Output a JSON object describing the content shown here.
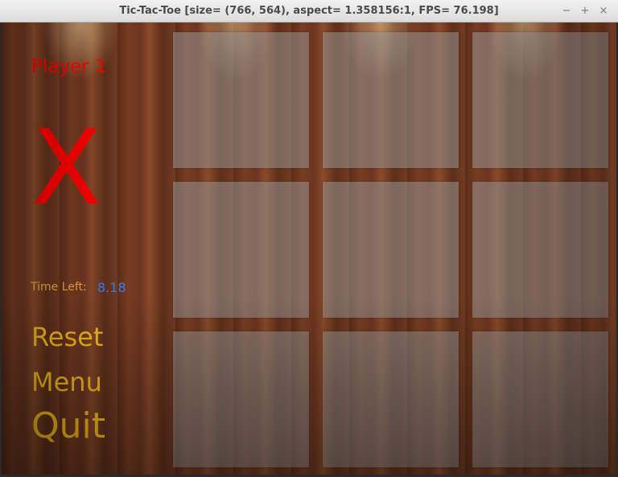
{
  "window": {
    "title": "Tic-Tac-Toe [size= (766, 564), aspect= 1.358156:1, FPS= 76.198]",
    "minimize_glyph": "−",
    "maximize_glyph": "+",
    "close_glyph": "×"
  },
  "game": {
    "player_label": "Player 1",
    "current_mark": "X",
    "time_label": "Time Left:",
    "time_value": "8.18",
    "buttons": {
      "reset": "Reset",
      "menu": "Menu",
      "quit": "Quit"
    },
    "board": [
      "",
      "",
      "",
      "",
      "",
      "",
      "",
      "",
      ""
    ],
    "colors": {
      "player": "#ff0000",
      "time_label": "#e8a840",
      "time_value": "#3a7ef0",
      "buttons": "#ffc21a"
    }
  }
}
